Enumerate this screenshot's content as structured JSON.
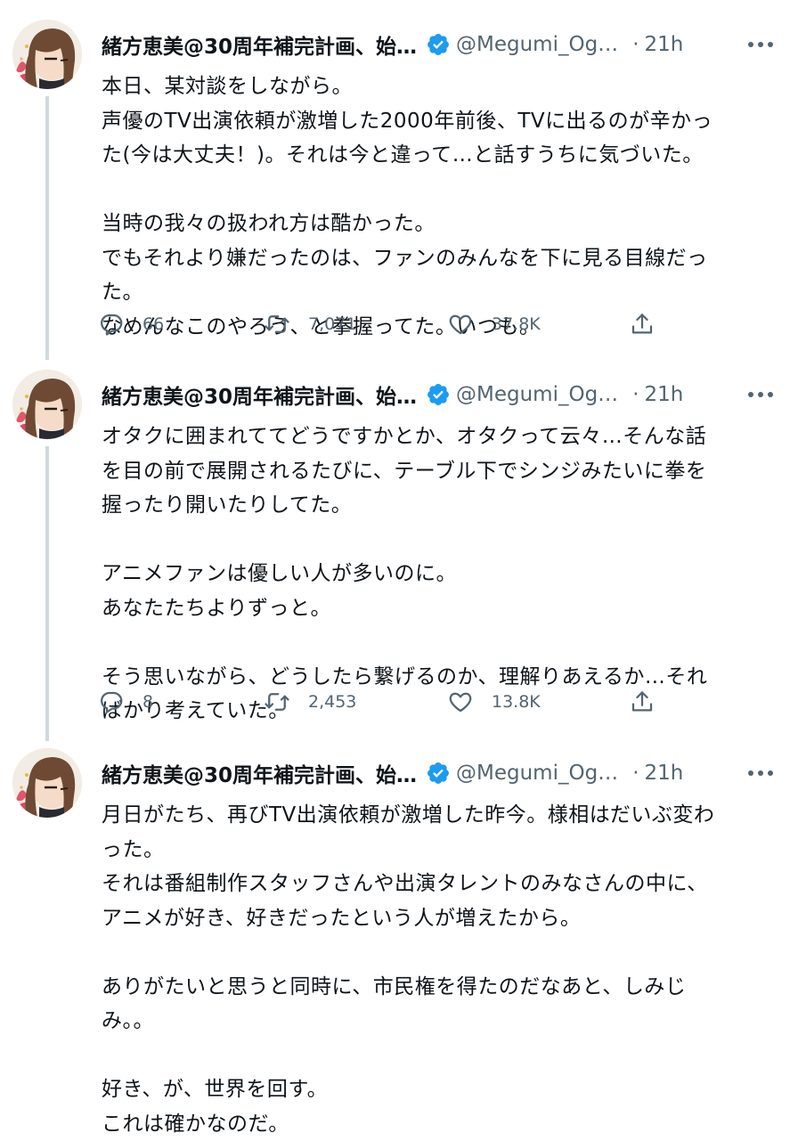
{
  "tweets": [
    {
      "author_name": "緒方恵美@30周年補完計画、始…",
      "handle": "@Megumi_Og…",
      "separator": "·",
      "time": "21h",
      "lines": [
        "本日、某対談をしながら。",
        "声優のTV出演依頼が激増した2000年前後、TVに出るのが辛かっ",
        "た(今は大丈夫！)。それは今と違って…と話すうちに気づいた。",
        "",
        "当時の我々の扱われ方は酷かった。",
        "でもそれより嫌だったのは、ファンのみんなを下に見る目線だっ",
        "た。",
        "なめんなこのやろう、と拳握ってた。いつも。"
      ],
      "replies": "66",
      "retweets": "7,071",
      "likes": "37.8K"
    },
    {
      "author_name": "緒方恵美@30周年補完計画、始…",
      "handle": "@Megumi_Og…",
      "separator": "·",
      "time": "21h",
      "lines": [
        "オタクに囲まれててどうですかとか、オタクって云々…そんな話",
        "を目の前で展開されるたびに、テーブル下でシンジみたいに拳を",
        "握ったり開いたりしてた。",
        "",
        "アニメファンは優しい人が多いのに。",
        "あなたたちよりずっと。",
        "",
        "そう思いながら、どうしたら繋げるのか、理解りあえるか…それ",
        "ばかり考えていた。"
      ],
      "replies": "8",
      "retweets": "2,453",
      "likes": "13.8K"
    },
    {
      "author_name": "緒方恵美@30周年補完計画、始…",
      "handle": "@Megumi_Og…",
      "separator": "·",
      "time": "21h",
      "lines": [
        "月日がたち、再びTV出演依頼が激増した昨今。様相はだいぶ変わ",
        "った。",
        "それは番組制作スタッフさんや出演タレントのみなさんの中に、",
        "アニメが好き、好きだったという人が増えたから。",
        "",
        "ありがたいと思うと同時に、市民権を得たのだなあと、しみじ",
        "み。。",
        "",
        "好き、が、世界を回す。",
        "これは確かなのだ。"
      ]
    }
  ],
  "colors": {
    "text": "#0f1419",
    "secondary": "#536471",
    "verified": "#1d9bf0",
    "thread_line": "#cfd9de"
  },
  "icons": [
    "verified-badge-icon",
    "more-icon",
    "reply-icon",
    "retweet-icon",
    "like-icon",
    "share-icon"
  ]
}
